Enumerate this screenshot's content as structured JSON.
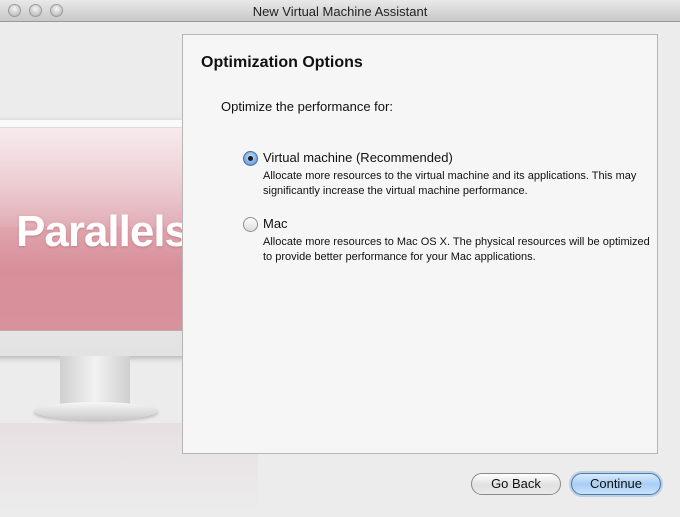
{
  "window": {
    "title": "New Virtual Machine Assistant"
  },
  "artwork": {
    "logo_text": "Parallels",
    "trademark": "™"
  },
  "panel": {
    "title": "Optimization Options",
    "prompt": "Optimize the performance for:",
    "options": [
      {
        "label": "Virtual machine (Recommended)",
        "description": "Allocate more resources to the virtual machine and its applications. This may significantly increase the virtual machine performance.",
        "selected": true
      },
      {
        "label": "Mac",
        "description": "Allocate more resources to Mac OS X. The physical resources will be optimized to provide better performance for your Mac applications.",
        "selected": false
      }
    ]
  },
  "buttons": {
    "back_label": "Go Back",
    "continue_label": "Continue"
  },
  "colors": {
    "accent": "#7fb0e8",
    "screen": "#d98f9a"
  }
}
